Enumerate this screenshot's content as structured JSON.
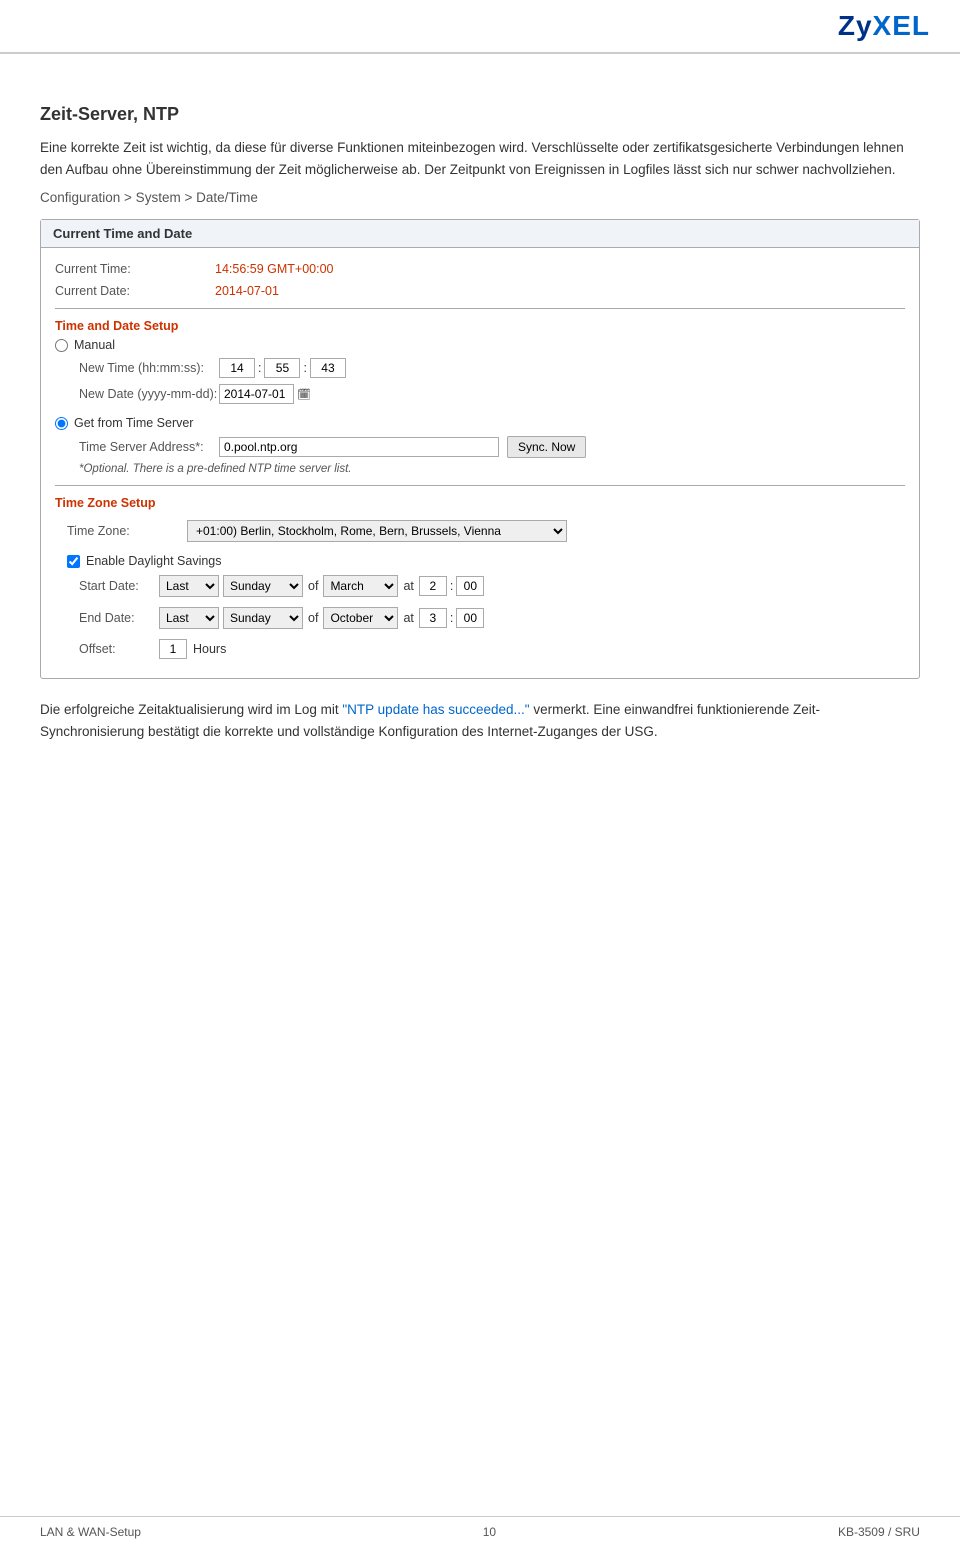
{
  "header": {
    "logo": "ZyXEL"
  },
  "page": {
    "title": "Zeit-Server, NTP",
    "paragraph1": "Eine korrekte Zeit ist wichtig, da diese für diverse Funktionen miteinbezogen wird. Verschlüsselte oder zertifikatsgesicherte Verbindungen lehnen den Aufbau ohne Übereinstimmung der Zeit möglicherweise ab. Der Zeitpunkt von Ereignissen in Logfiles lässt sich nur schwer nachvollziehen.",
    "breadcrumb": "Configuration > System > Date/Time"
  },
  "panel": {
    "current_time_section": "Current Time and Date",
    "current_time_label": "Current Time:",
    "current_time_value": "14:56:59 GMT+00:00",
    "current_date_label": "Current Date:",
    "current_date_value": "2014-07-01",
    "time_date_setup_section": "Time and Date Setup",
    "manual_label": "Manual",
    "new_time_label": "New Time (hh:mm:ss):",
    "new_time_h": "14",
    "new_time_m": "55",
    "new_time_s": "43",
    "new_date_label": "New Date (yyyy-mm-dd):",
    "new_date_value": "2014-07-01",
    "get_from_server_label": "Get from Time Server",
    "time_server_label": "Time Server Address*:",
    "time_server_value": "0.pool.ntp.org",
    "sync_now_label": "Sync. Now",
    "ntp_note": "*Optional. There is a pre-defined NTP time server list.",
    "time_zone_section": "Time Zone Setup",
    "time_zone_label": "Time Zone:",
    "time_zone_value": "+01:00) Berlin, Stockholm, Rome, Bern, Brussels, Vienna",
    "enable_dst_label": "Enable Daylight Savings",
    "start_date_label": "Start Date:",
    "start_last": "Last",
    "start_sunday": "Sunday",
    "start_of": "of",
    "start_month": "March",
    "start_at": "at",
    "start_hour": "2",
    "start_minute": "00",
    "end_date_label": "End Date:",
    "end_last": "Last",
    "end_sunday": "Sunday",
    "end_of": "of",
    "end_month": "October",
    "end_at": "at",
    "end_hour": "3",
    "end_minute": "00",
    "offset_label": "Offset:",
    "offset_value": "1",
    "hours_label": "Hours"
  },
  "footer_text": {
    "part1": "Die erfolgreiche Zeitaktualisierung wird im Log mit ",
    "part2": "\"NTP update has succeeded...\"",
    "part3": " vermerkt. Eine einwandfrei funktionierende Zeit-Synchronisierung bestätigt die korrekte und vollständige Konfiguration des Internet-Zuganges der USG."
  },
  "page_footer": {
    "left": "LAN & WAN-Setup",
    "center": "10",
    "right": "KB-3509 / SRU"
  }
}
